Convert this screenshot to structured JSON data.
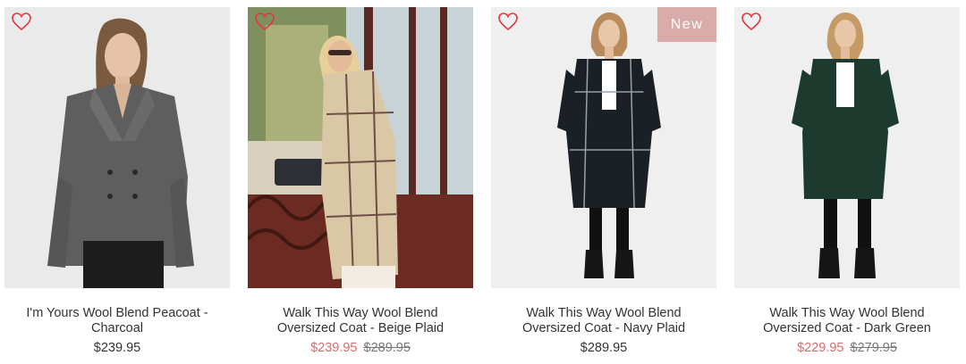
{
  "colors": {
    "heart": "#e0373f",
    "badge_bg": "#d9acaa",
    "sale_price": "#d86a6a",
    "text": "#333333"
  },
  "products": [
    {
      "name_line1": "I'm Yours Wool Blend Peacoat -",
      "name_line2": "Charcoal",
      "price": "$239.95",
      "badge": "",
      "wishlist_icon": "heart-outline-icon"
    },
    {
      "name_line1": "Walk This Way Wool Blend",
      "name_line2": "Oversized Coat - Beige Plaid",
      "sale_price": "$239.95",
      "original_price": "$289.95",
      "wishlist_icon": "heart-outline-icon"
    },
    {
      "name_line1": "Walk This Way Wool Blend",
      "name_line2": "Oversized Coat - Navy Plaid",
      "price": "$289.95",
      "badge": "New",
      "wishlist_icon": "heart-outline-icon"
    },
    {
      "name_line1": "Walk This Way Wool Blend",
      "name_line2": "Oversized Coat - Dark Green",
      "sale_price": "$229.95",
      "original_price": "$279.95",
      "wishlist_icon": "heart-outline-icon"
    }
  ]
}
